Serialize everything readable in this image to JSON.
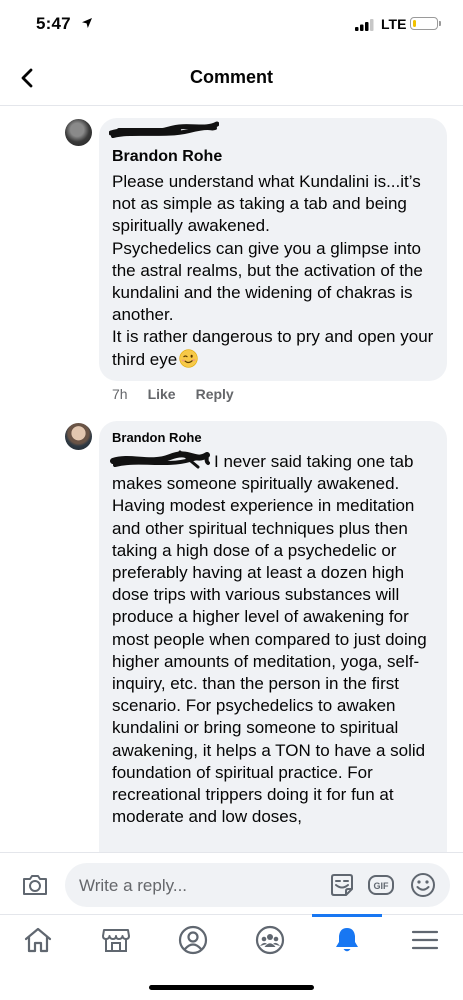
{
  "status_bar": {
    "time": "5:47",
    "network": "LTE",
    "battery_level": 0.15,
    "icons": [
      "location-arrow-icon",
      "signal-icon",
      "battery-icon"
    ]
  },
  "header": {
    "title": "Comment",
    "back_icon": "chevron-left-icon"
  },
  "comments": [
    {
      "author": "Brandon Rohe",
      "body": "Please understand what Kundalini is...it’s not as simple as taking a tab and being spiritually awakened.\nPsychedelics can give you a glimpse into the astral realms, but the activation of the kundalini and the widening of chakras is another.\nIt is rather dangerous to pry and open your third eye",
      "emoji": "winking-face-emoji",
      "time": "7h",
      "like_label": "Like",
      "reply_label": "Reply"
    },
    {
      "author": "Brandon Rohe",
      "body": "I never said taking one tab makes someone spiritually awakened. Having modest experience in meditation and other spiritual techniques plus then taking a high dose of a psychedelic or preferably having at least a dozen high dose trips with various substances will produce a higher level of awakening for most people when compared to just doing higher amounts of meditation, yoga, self-inquiry, etc. than the person in the first scenario. For psychedelics to awaken kundalini or bring someone to spiritual awakening, it helps a TON to have a solid foundation of spiritual practice. For recreational trippers doing it for fun at moderate and low doses,"
    }
  ],
  "composer": {
    "placeholder": "Write a reply...",
    "icons": [
      "camera-icon",
      "sticker-icon",
      "gif-icon",
      "emoji-icon"
    ]
  },
  "tabbar": {
    "items": [
      "home-icon",
      "marketplace-icon",
      "profile-icon",
      "groups-icon",
      "notifications-icon",
      "menu-icon"
    ],
    "active": "notifications-icon",
    "accent": "#1877f2"
  }
}
